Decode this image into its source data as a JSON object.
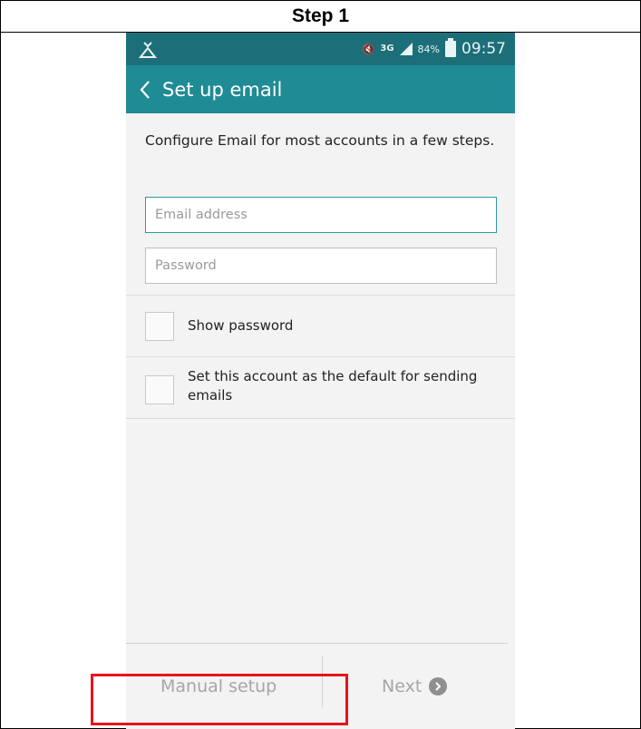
{
  "header": {
    "step_title": "Step 1"
  },
  "statusbar": {
    "battery": "84%",
    "time": "09:57",
    "network": "3G"
  },
  "appbar": {
    "title": "Set up email",
    "back_icon": "chevron-left-icon"
  },
  "form": {
    "intro": "Configure Email for most accounts in a few steps.",
    "email_placeholder": "Email address",
    "email_value": "",
    "password_placeholder": "Password",
    "password_value": ""
  },
  "options": {
    "show_password": {
      "label": "Show password",
      "checked": false
    },
    "default_account": {
      "label": "Set this account as the default for sending emails",
      "checked": false
    }
  },
  "footer": {
    "manual_setup_label": "Manual setup",
    "next_label": "Next"
  },
  "colors": {
    "status_bar": "#1c6f79",
    "app_bar": "#1f8b95",
    "highlight_box": "#e8141b"
  }
}
